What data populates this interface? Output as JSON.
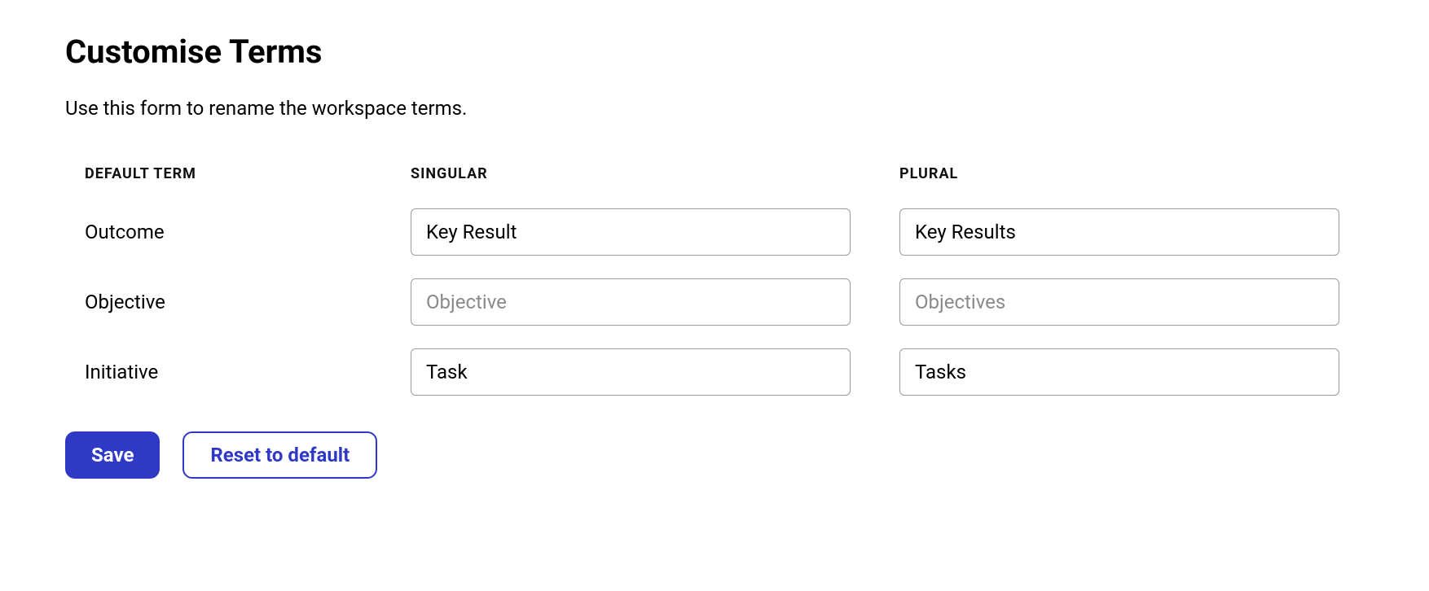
{
  "page": {
    "title": "Customise Terms",
    "description": "Use this form to rename the workspace terms."
  },
  "headers": {
    "default_term": "DEFAULT TERM",
    "singular": "SINGULAR",
    "plural": "PLURAL"
  },
  "rows": [
    {
      "default_term": "Outcome",
      "singular_value": "Key Result",
      "singular_placeholder": "",
      "plural_value": "Key Results",
      "plural_placeholder": ""
    },
    {
      "default_term": "Objective",
      "singular_value": "",
      "singular_placeholder": "Objective",
      "plural_value": "",
      "plural_placeholder": "Objectives"
    },
    {
      "default_term": "Initiative",
      "singular_value": "Task",
      "singular_placeholder": "",
      "plural_value": "Tasks",
      "plural_placeholder": ""
    }
  ],
  "actions": {
    "save_label": "Save",
    "reset_label": "Reset to default"
  }
}
